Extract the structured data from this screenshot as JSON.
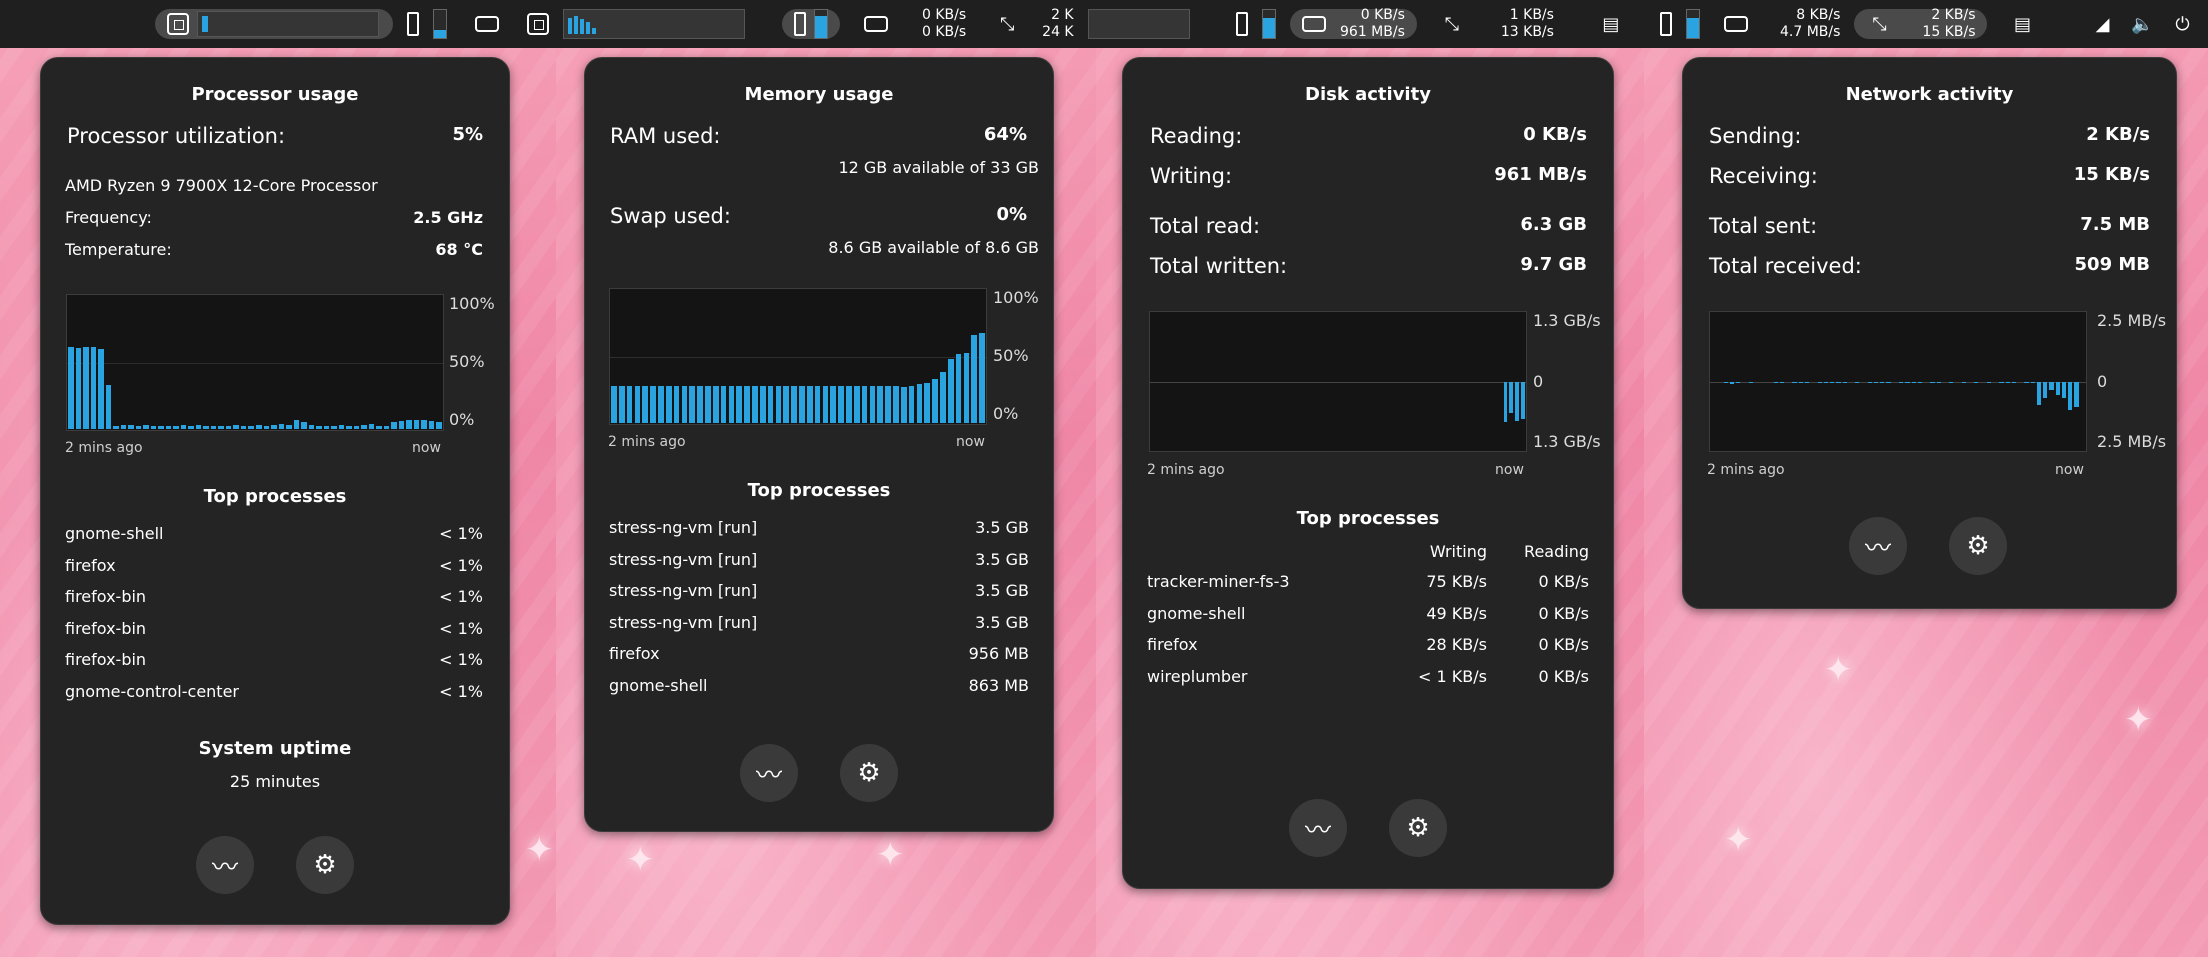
{
  "topbar": {
    "s1": {
      "rates_up": "0 KB/s",
      "rates_down": "0 KB/s"
    },
    "s2": {
      "rate_a": "2 K",
      "rate_b": "24 K"
    },
    "s3": {
      "disk_read": "0 KB/s",
      "disk_write": "961 MB/s",
      "net_up": "1 KB/s",
      "net_down": "13 KB/s"
    },
    "s4": {
      "disk_read": "8 KB/s",
      "disk_write": "4.7 MB/s",
      "net_up": "2 KB/s",
      "net_down": "15 KB/s"
    }
  },
  "cpu": {
    "title": "Processor usage",
    "util_label": "Processor utilization:",
    "util_value": "5%",
    "model": "AMD Ryzen 9 7900X 12-Core Processor",
    "freq_label": "Frequency:",
    "freq_value": "2.5 GHz",
    "temp_label": "Temperature:",
    "temp_value": "68 °C",
    "axis": [
      "100%",
      "50%",
      "0%"
    ],
    "time_start": "2 mins ago",
    "time_end": "now",
    "history": [
      62,
      61,
      62,
      62,
      60,
      33,
      2,
      3,
      3,
      2,
      3,
      2,
      2,
      2,
      2,
      3,
      2,
      3,
      2,
      2,
      2,
      2,
      3,
      2,
      2,
      3,
      2,
      3,
      4,
      3,
      7,
      5,
      3,
      2,
      2,
      2,
      3,
      2,
      2,
      3,
      4,
      2,
      2,
      5,
      6,
      7,
      7,
      7,
      6,
      5
    ],
    "top_title": "Top processes",
    "processes": [
      {
        "name": "gnome-shell",
        "value": "< 1%"
      },
      {
        "name": "firefox",
        "value": "< 1%"
      },
      {
        "name": "firefox-bin",
        "value": "< 1%"
      },
      {
        "name": "firefox-bin",
        "value": "< 1%"
      },
      {
        "name": "firefox-bin",
        "value": "< 1%"
      },
      {
        "name": "gnome-control-center",
        "value": "< 1%"
      }
    ],
    "uptime_title": "System uptime",
    "uptime_value": "25 minutes"
  },
  "mem": {
    "title": "Memory usage",
    "ram_label": "RAM used:",
    "ram_value": "64%",
    "ram_avail": "12 GB available of 33 GB",
    "swap_label": "Swap used:",
    "swap_value": "0%",
    "swap_avail": "8.6 GB available of 8.6 GB",
    "axis": [
      "100%",
      "50%",
      "0%"
    ],
    "time_start": "2 mins ago",
    "time_end": "now",
    "history": [
      28,
      28,
      28,
      28,
      28,
      28,
      28,
      28,
      28,
      28,
      28,
      28,
      28,
      28,
      28,
      28,
      28,
      28,
      28,
      28,
      28,
      28,
      28,
      28,
      28,
      28,
      28,
      28,
      28,
      28,
      28,
      28,
      28,
      28,
      28,
      28,
      28,
      27,
      28,
      29,
      30,
      33,
      38,
      48,
      52,
      53,
      66,
      68
    ],
    "top_title": "Top processes",
    "processes": [
      {
        "name": "stress-ng-vm [run]",
        "value": "3.5 GB"
      },
      {
        "name": "stress-ng-vm [run]",
        "value": "3.5 GB"
      },
      {
        "name": "stress-ng-vm [run]",
        "value": "3.5 GB"
      },
      {
        "name": "stress-ng-vm [run]",
        "value": "3.5 GB"
      },
      {
        "name": "firefox",
        "value": "956 MB"
      },
      {
        "name": "gnome-shell",
        "value": "863 MB"
      }
    ]
  },
  "disk": {
    "title": "Disk activity",
    "reading_label": "Reading:",
    "reading_value": "0 KB/s",
    "writing_label": "Writing:",
    "writing_value": "961 MB/s",
    "tread_label": "Total read:",
    "tread_value": "6.3 GB",
    "twritten_label": "Total written:",
    "twritten_value": "9.7 GB",
    "axis_top": "1.3 GB/s",
    "axis_mid": "0",
    "axis_bot": "1.3 GB/s",
    "time_start": "2 mins ago",
    "time_end": "now",
    "write_history": [
      0,
      0,
      0,
      0,
      0,
      0,
      0,
      0,
      0,
      0,
      0,
      0,
      0,
      0,
      0,
      0,
      0,
      0,
      0,
      0,
      0,
      0,
      0,
      0,
      0,
      0,
      0,
      0,
      0,
      0,
      0,
      0,
      0,
      0,
      0,
      0,
      0,
      0,
      0,
      0,
      0,
      0,
      0,
      0,
      0,
      0,
      0,
      0,
      0,
      0,
      0,
      0,
      0,
      0,
      0,
      0,
      0,
      0,
      0,
      0,
      60,
      46,
      58,
      56
    ],
    "top_title": "Top processes",
    "col_writing": "Writing",
    "col_reading": "Reading",
    "processes": [
      {
        "name": "tracker-miner-fs-3",
        "writing": "75 KB/s",
        "reading": "0 KB/s"
      },
      {
        "name": "gnome-shell",
        "writing": "49 KB/s",
        "reading": "0 KB/s"
      },
      {
        "name": "firefox",
        "writing": "28 KB/s",
        "reading": "0 KB/s"
      },
      {
        "name": "wireplumber",
        "writing": "< 1 KB/s",
        "reading": "0 KB/s"
      }
    ]
  },
  "net": {
    "title": "Network activity",
    "sending_label": "Sending:",
    "sending_value": "2 KB/s",
    "receiving_label": "Receiving:",
    "receiving_value": "15 KB/s",
    "tsent_label": "Total sent:",
    "tsent_value": "7.5 MB",
    "treceived_label": "Total received:",
    "treceived_value": "509 MB",
    "axis_top": "2.5 MB/s",
    "axis_mid": "0",
    "axis_bot": "2.5 MB/s",
    "time_start": "2 mins ago",
    "time_end": "now",
    "recv_history": [
      0,
      0,
      2,
      4,
      1,
      0,
      1,
      0,
      0,
      0,
      1,
      1,
      0,
      1,
      1,
      1,
      0,
      1,
      1,
      1,
      1,
      1,
      0,
      1,
      0,
      1,
      1,
      1,
      1,
      0,
      1,
      1,
      1,
      1,
      0,
      1,
      1,
      0,
      1,
      0,
      1,
      0,
      1,
      0,
      1,
      0,
      1,
      1,
      1,
      0,
      2,
      2,
      35,
      25,
      12,
      20,
      24,
      42,
      38,
      0
    ],
    "top_title": "",
    "processes": []
  }
}
